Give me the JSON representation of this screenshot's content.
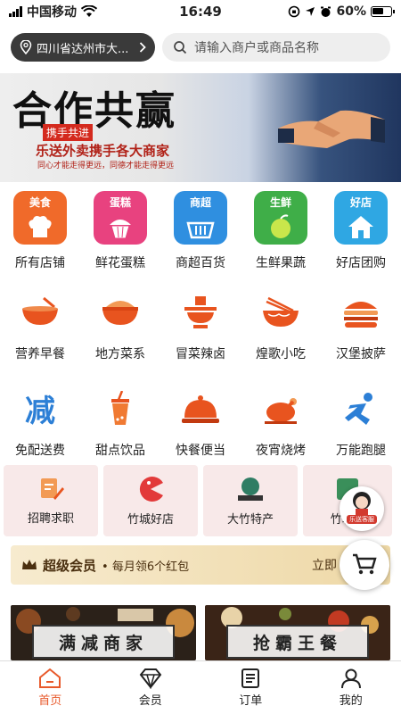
{
  "status": {
    "carrier": "中国移动",
    "time": "16:49",
    "battery": "60%"
  },
  "header": {
    "location": "四川省达州市大...",
    "search_placeholder": "请输入商户或商品名称"
  },
  "banner": {
    "headline": "合作共赢",
    "tag": "携手共进",
    "subtitle": "乐送外卖携手各大商家",
    "tagline": "同心才能走得更远，同德才能走得更远"
  },
  "categories": [
    {
      "label": "所有店铺",
      "badge": "美食",
      "color": "#f06a2a",
      "icon": "chef-hat-icon"
    },
    {
      "label": "鲜花蛋糕",
      "badge": "蛋糕",
      "color": "#e8427f",
      "icon": "cupcake-icon"
    },
    {
      "label": "商超百货",
      "badge": "商超",
      "color": "#2f8fe0",
      "icon": "basket-icon"
    },
    {
      "label": "生鲜果蔬",
      "badge": "生鲜",
      "color": "#3fae48",
      "icon": "apple-icon"
    },
    {
      "label": "好店团购",
      "badge": "好店",
      "color": "#2fa7e3",
      "icon": "house-icon"
    }
  ],
  "food_types": [
    {
      "label": "营养早餐",
      "icon": "soup-bowl-icon"
    },
    {
      "label": "地方菜系",
      "icon": "rice-bowl-icon"
    },
    {
      "label": "冒菜辣卤",
      "icon": "hotpot-icon"
    },
    {
      "label": "煌歌小吃",
      "icon": "noodle-bowl-icon"
    },
    {
      "label": "汉堡披萨",
      "icon": "burger-icon"
    },
    {
      "label": "免配送费",
      "icon": "discount-icon"
    },
    {
      "label": "甜点饮品",
      "icon": "drink-cup-icon"
    },
    {
      "label": "快餐便当",
      "icon": "cloche-icon"
    },
    {
      "label": "夜宵烧烤",
      "icon": "roast-chicken-icon"
    },
    {
      "label": "万能跑腿",
      "icon": "runner-icon"
    }
  ],
  "services": [
    {
      "label": "招聘求职",
      "icon": "recruit-icon"
    },
    {
      "label": "竹城好店",
      "icon": "pacman-icon"
    },
    {
      "label": "大竹特产",
      "icon": "specialty-logo-icon"
    },
    {
      "label": "竹城...",
      "icon": "store-logo-icon"
    }
  ],
  "customer_service": {
    "label": "乐送客服"
  },
  "vip": {
    "title": "超级会员",
    "subtitle": "• 每月领6个红包",
    "cta": "立即"
  },
  "features": [
    {
      "label": "满减商家"
    },
    {
      "label": "抢霸王餐"
    }
  ],
  "tabs": [
    {
      "label": "首页",
      "icon": "home-icon",
      "active": true
    },
    {
      "label": "会员",
      "icon": "diamond-icon",
      "active": false
    },
    {
      "label": "订单",
      "icon": "order-list-icon",
      "active": false
    },
    {
      "label": "我的",
      "icon": "user-icon",
      "active": false
    }
  ],
  "colors": {
    "accent": "#e85a2c",
    "orange_icon": "#e8541f",
    "vip_text": "#4a2f0f"
  }
}
